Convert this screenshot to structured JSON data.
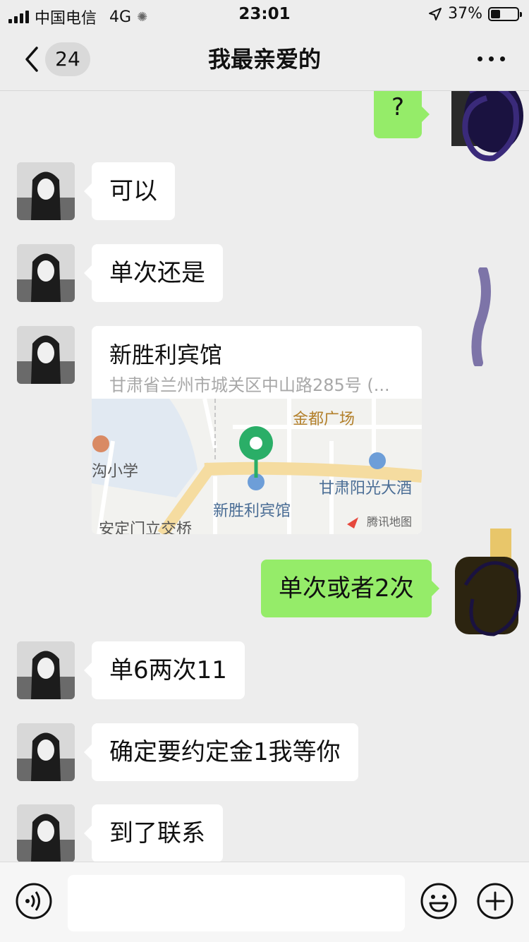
{
  "status_bar": {
    "carrier": "中国电信",
    "network": "4G",
    "time": "23:01",
    "battery_percent": "37%",
    "battery_level": 0.37
  },
  "nav": {
    "unread_count": "24",
    "title": "我最亲爱的",
    "back_icon": "chevron-left-icon",
    "more_icon": "more-dots-icon"
  },
  "messages": [
    {
      "side": "right",
      "text": "?"
    },
    {
      "side": "left",
      "text": "可以"
    },
    {
      "side": "left",
      "text": "单次还是"
    },
    {
      "side": "left",
      "type": "location",
      "name": "新胜利宾馆",
      "address": "甘肃省兰州市城关区中山路285号 (...",
      "map_labels": [
        "金都广场",
        "甘肃阳光大酒",
        "沟小学",
        "新胜利宾馆",
        "安定门立交桥",
        "腾讯地图"
      ]
    },
    {
      "side": "right",
      "text": "单次或者2次"
    },
    {
      "side": "left",
      "text": "单6两次11"
    },
    {
      "side": "left",
      "text": "确定要约定金1我等你"
    },
    {
      "side": "left",
      "text": "到了联系"
    }
  ],
  "input_bar": {
    "placeholder": "",
    "voice_icon": "voice-icon",
    "emoji_icon": "emoji-icon",
    "plus_icon": "plus-icon"
  },
  "colors": {
    "background": "#ededed",
    "self_bubble": "#95ec69",
    "other_bubble": "#ffffff",
    "pin": "#2aae67"
  }
}
